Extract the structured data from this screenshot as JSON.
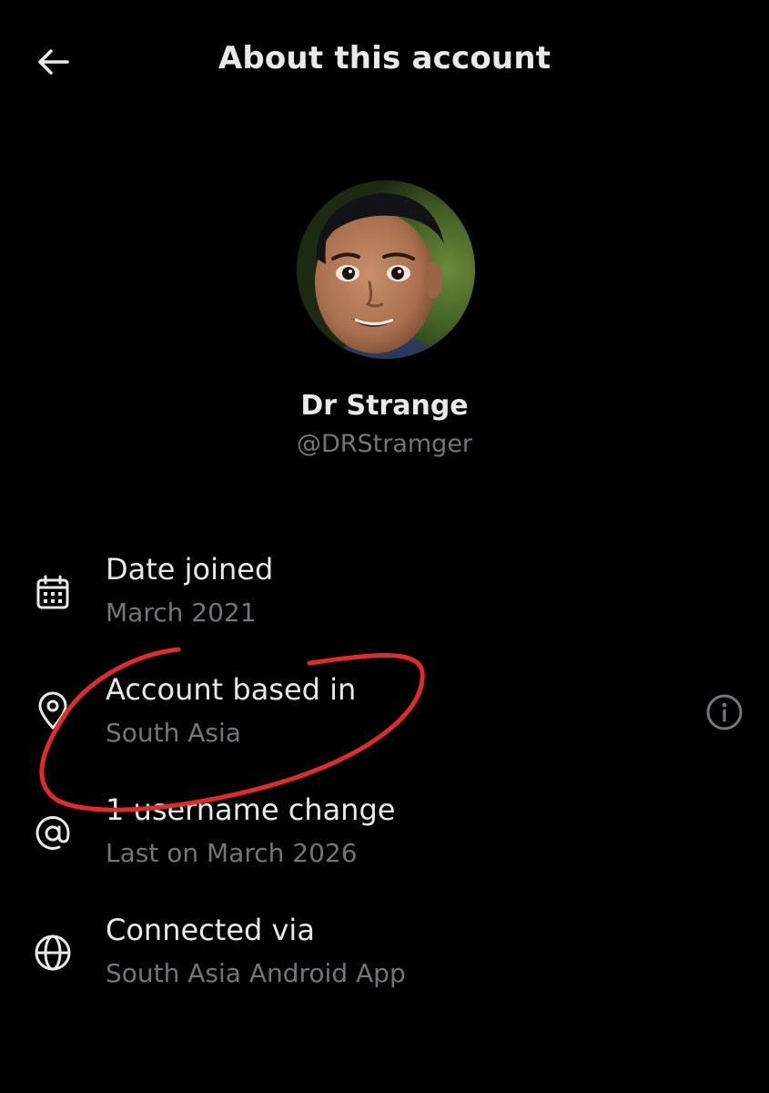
{
  "header": {
    "back_icon": "arrow-left-icon",
    "title": "About this account"
  },
  "profile": {
    "display_name": "Dr Strange",
    "handle": "@DRStramger",
    "avatar": "profile-photo"
  },
  "rows": [
    {
      "icon": "calendar-icon",
      "title": "Date joined",
      "subtitle": "March 2021"
    },
    {
      "icon": "location-pin-icon",
      "title": "Account based in",
      "subtitle": "South Asia",
      "trailing_icon": "info-icon"
    },
    {
      "icon": "at-sign-icon",
      "title": "1 username change",
      "subtitle": "Last on March 2026"
    },
    {
      "icon": "globe-icon",
      "title": "Connected via",
      "subtitle": "South Asia Android App"
    }
  ],
  "annotation": {
    "color": "#e02b2b",
    "shape": "hand-drawn circle around Account based in row"
  },
  "colors": {
    "background": "#000000",
    "primary_text": "#e7e9ea",
    "secondary_text": "#71767b"
  }
}
